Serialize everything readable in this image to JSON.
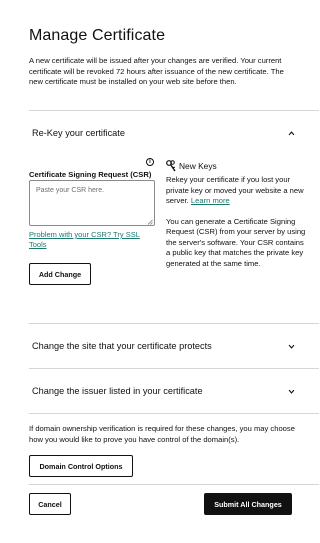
{
  "header": {
    "title": "Manage Certificate",
    "intro": "A new certificate will be issued after your changes are verified. Your current certificate will be revoked 72 hours after issuance of the new certificate. The new certificate must be installed on your web site before then."
  },
  "rekey": {
    "heading": "Re-Key your certificate",
    "csr_label": "Certificate Signing Request (CSR)",
    "info_glyph": "i",
    "csr_placeholder": "Paste your CSR here.",
    "csr_value": "",
    "problem_link": "Problem with your CSR? Try SSL Tools",
    "add_change_label": "Add Change",
    "new_keys_title": "New Keys",
    "new_keys_p1": "Rekey your certificate if you lost your private key or moved your website a new server.",
    "learn_more": "Learn more",
    "new_keys_p2": "You can generate a Certificate Signing Request (CSR) from your server by using the server's software. Your CSR contains a public key that matches the private key generated at the same time."
  },
  "sections": {
    "change_site": "Change the site that your certificate protects",
    "change_issuer": "Change the issuer listed in your certificate"
  },
  "footer": {
    "note": "If domain ownership verification is required for these changes, you may choose how you would like to prove you have control of the domain(s).",
    "domain_control_label": "Domain Control Options",
    "cancel_label": "Cancel",
    "submit_label": "Submit All Changes"
  },
  "colors": {
    "link": "#1a7a6e",
    "primary_button": "#111111",
    "divider": "#d6d6d6"
  }
}
